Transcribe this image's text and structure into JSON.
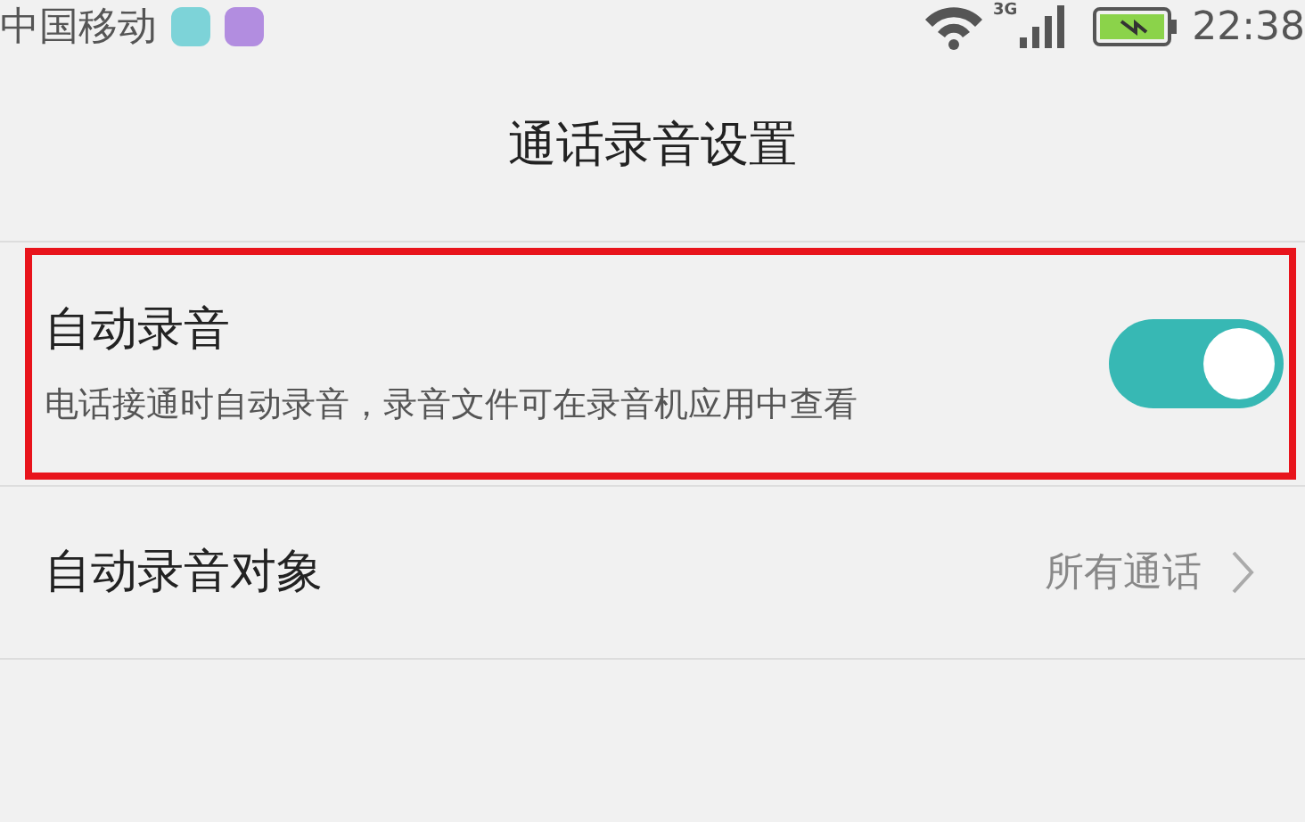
{
  "status_bar": {
    "carrier": "中国移动",
    "network": "3G",
    "time": "22:38"
  },
  "title": "通话录音设置",
  "settings": [
    {
      "kind": "toggle",
      "label": "自动录音",
      "description": "电话接通时自动录音，录音文件可在录音机应用中查看",
      "on": true,
      "highlighted": true
    },
    {
      "kind": "link",
      "label": "自动录音对象",
      "value": "所有通话",
      "highlighted": false
    }
  ]
}
